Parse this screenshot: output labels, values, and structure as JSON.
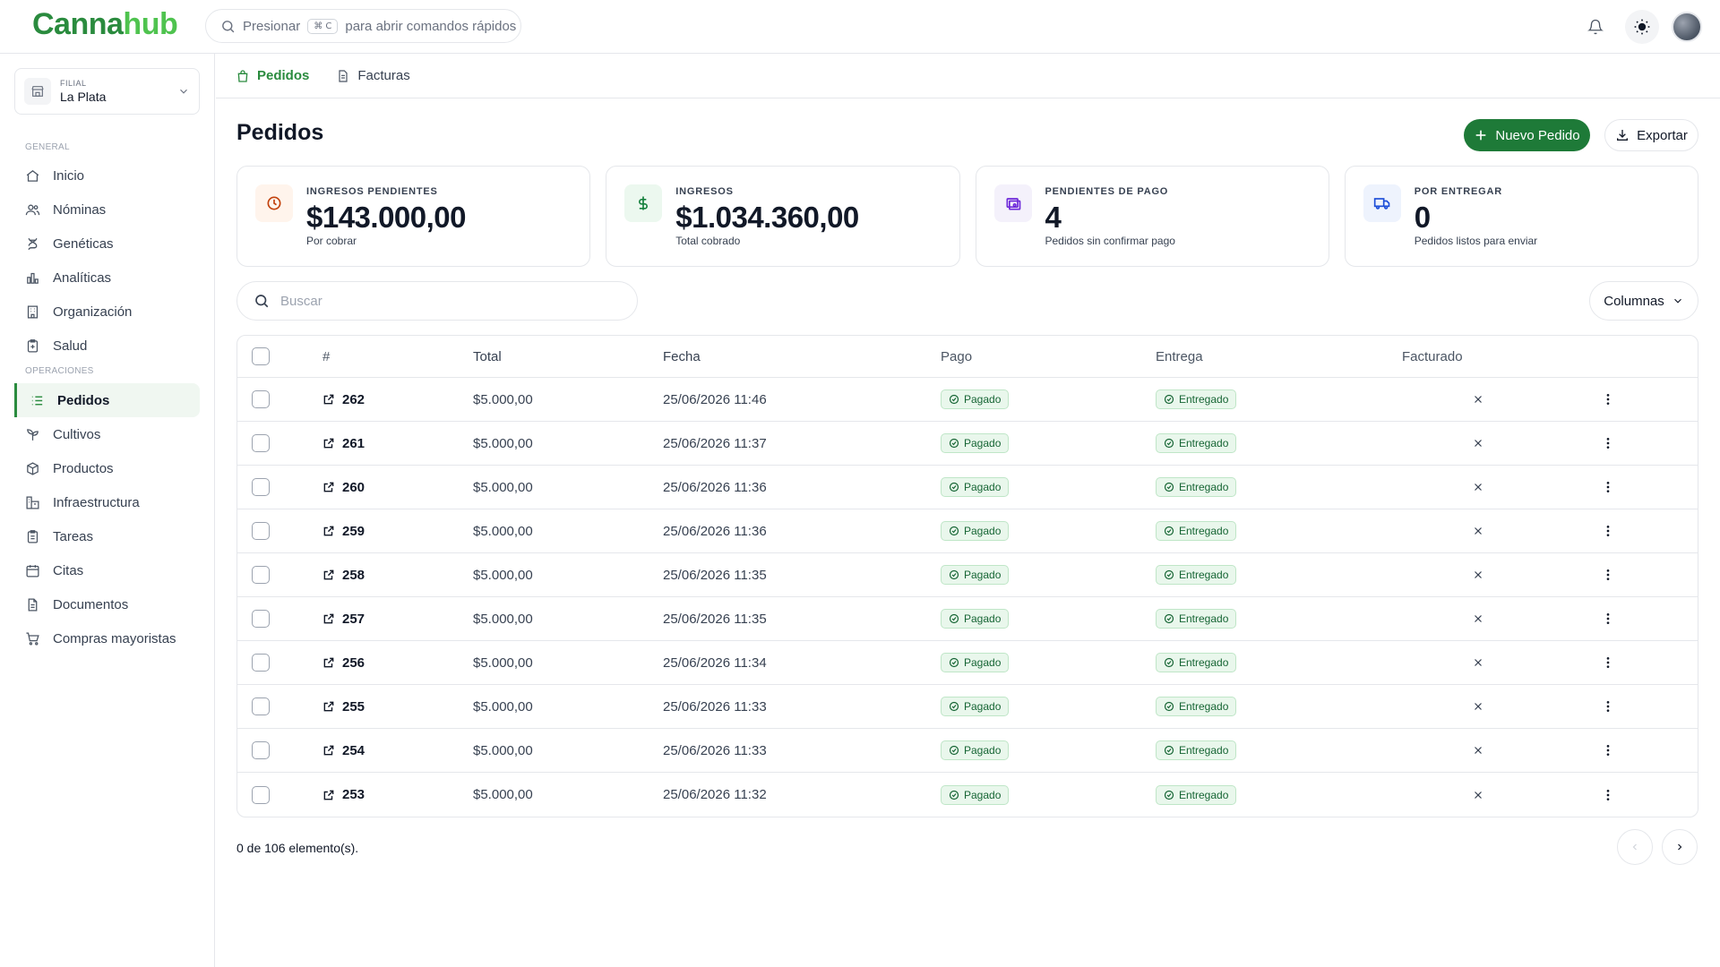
{
  "app": {
    "logo_part1": "Canna",
    "logo_part2": "hub"
  },
  "command": {
    "prefix": "Presionar",
    "shortcut": "⌘ C",
    "suffix": "para abrir comandos rápidos"
  },
  "branch": {
    "caption": "FILIAL",
    "value": "La Plata"
  },
  "sidebar": {
    "general_title": "GENERAL",
    "general_items": [
      {
        "label": "Inicio",
        "icon": "home-icon"
      },
      {
        "label": "Nóminas",
        "icon": "users-icon"
      },
      {
        "label": "Genéticas",
        "icon": "dna-icon"
      },
      {
        "label": "Analíticas",
        "icon": "bar-chart-icon"
      },
      {
        "label": "Organización",
        "icon": "building-icon"
      },
      {
        "label": "Salud",
        "icon": "clipboard-plus-icon"
      }
    ],
    "ops_title": "OPERACIONES",
    "ops_items": [
      {
        "label": "Pedidos",
        "icon": "list-icon",
        "active": true
      },
      {
        "label": "Cultivos",
        "icon": "sprout-icon"
      },
      {
        "label": "Productos",
        "icon": "package-icon"
      },
      {
        "label": "Infraestructura",
        "icon": "infrastructure-icon"
      },
      {
        "label": "Tareas",
        "icon": "clipboard-icon"
      },
      {
        "label": "Citas",
        "icon": "calendar-icon"
      },
      {
        "label": "Documentos",
        "icon": "file-icon"
      },
      {
        "label": "Compras mayoristas",
        "icon": "cart-icon"
      }
    ]
  },
  "tabs": [
    {
      "label": "Pedidos",
      "icon": "bag-icon",
      "active": true
    },
    {
      "label": "Facturas",
      "icon": "receipt-icon",
      "active": false
    }
  ],
  "page": {
    "title": "Pedidos",
    "new_button": "Nuevo Pedido",
    "export_button": "Exportar"
  },
  "cards": [
    {
      "caption": "INGRESOS PENDIENTES",
      "value": "$143.000,00",
      "sub": "Por cobrar",
      "icon": "clock-icon",
      "color": "#c2410c",
      "bg": "#fff4ec"
    },
    {
      "caption": "INGRESOS",
      "value": "$1.034.360,00",
      "sub": "Total cobrado",
      "icon": "dollar-icon",
      "color": "#15803d",
      "bg": "#ecf8ef"
    },
    {
      "caption": "PENDIENTES DE PAGO",
      "value": "4",
      "sub": "Pedidos sin confirmar pago",
      "icon": "wallet-icon",
      "color": "#6d28d9",
      "bg": "#f4f1fb"
    },
    {
      "caption": "POR ENTREGAR",
      "value": "0",
      "sub": "Pedidos listos para enviar",
      "icon": "truck-icon",
      "color": "#1d4ed8",
      "bg": "#eef3fd"
    }
  ],
  "search": {
    "placeholder": "Buscar"
  },
  "columns_button": "Columnas",
  "table": {
    "headers": {
      "num": "#",
      "total": "Total",
      "fecha": "Fecha",
      "pago": "Pago",
      "entrega": "Entrega",
      "facturado": "Facturado"
    },
    "rows": [
      {
        "num": "262",
        "total": "$5.000,00",
        "fecha": "25/06/2026 11:46",
        "pago": "Pagado",
        "entrega": "Entregado"
      },
      {
        "num": "261",
        "total": "$5.000,00",
        "fecha": "25/06/2026 11:37",
        "pago": "Pagado",
        "entrega": "Entregado"
      },
      {
        "num": "260",
        "total": "$5.000,00",
        "fecha": "25/06/2026 11:36",
        "pago": "Pagado",
        "entrega": "Entregado"
      },
      {
        "num": "259",
        "total": "$5.000,00",
        "fecha": "25/06/2026 11:36",
        "pago": "Pagado",
        "entrega": "Entregado"
      },
      {
        "num": "258",
        "total": "$5.000,00",
        "fecha": "25/06/2026 11:35",
        "pago": "Pagado",
        "entrega": "Entregado"
      },
      {
        "num": "257",
        "total": "$5.000,00",
        "fecha": "25/06/2026 11:35",
        "pago": "Pagado",
        "entrega": "Entregado"
      },
      {
        "num": "256",
        "total": "$5.000,00",
        "fecha": "25/06/2026 11:34",
        "pago": "Pagado",
        "entrega": "Entregado"
      },
      {
        "num": "255",
        "total": "$5.000,00",
        "fecha": "25/06/2026 11:33",
        "pago": "Pagado",
        "entrega": "Entregado"
      },
      {
        "num": "254",
        "total": "$5.000,00",
        "fecha": "25/06/2026 11:33",
        "pago": "Pagado",
        "entrega": "Entregado"
      },
      {
        "num": "253",
        "total": "$5.000,00",
        "fecha": "25/06/2026 11:32",
        "pago": "Pagado",
        "entrega": "Entregado"
      }
    ]
  },
  "footer": {
    "count": "0 de 106 elemento(s)."
  },
  "colors": {
    "brand": "#1e7a38",
    "badge_bg": "#e9f7ec",
    "badge_text": "#166534"
  }
}
